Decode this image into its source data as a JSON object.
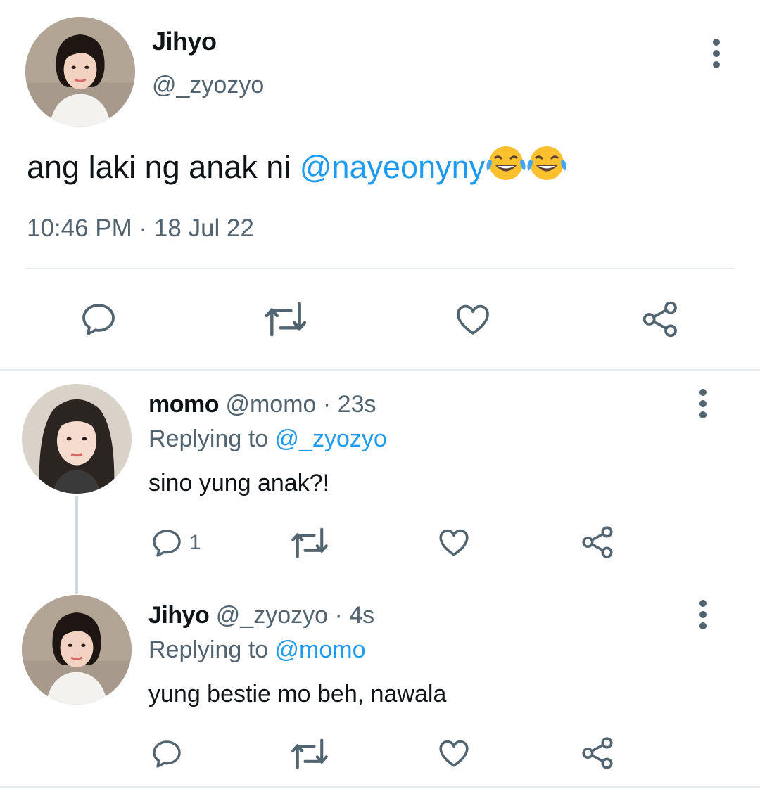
{
  "main_tweet": {
    "name": "Jihyo",
    "handle": "@_zyozyo",
    "text_before": "ang laki ng anak ni ",
    "mention": "@nayeonyny",
    "emoji": "😂😂",
    "timestamp": "10:46 PM · 18 Jul 22",
    "icons": [
      "more-vertical-icon",
      "reply-icon",
      "retweet-icon",
      "like-icon",
      "share-icon"
    ]
  },
  "replies": [
    {
      "name": "momo",
      "handle": "@momo",
      "separator": " · ",
      "time": "23s",
      "replying_label": "Replying to ",
      "replying_to": "@_zyozyo",
      "text": "sino yung anak?!",
      "reply_count": "1"
    },
    {
      "name": "Jihyo",
      "handle": "@_zyozyo",
      "separator": " · ",
      "time": "4s",
      "replying_label": "Replying to ",
      "replying_to": "@momo",
      "text": "yung bestie mo beh, nawala",
      "reply_count": ""
    }
  ],
  "colors": {
    "accent": "#1d9bf0",
    "secondary_text": "#536471",
    "primary_text": "#0f1419",
    "divider": "#e6ebee"
  }
}
